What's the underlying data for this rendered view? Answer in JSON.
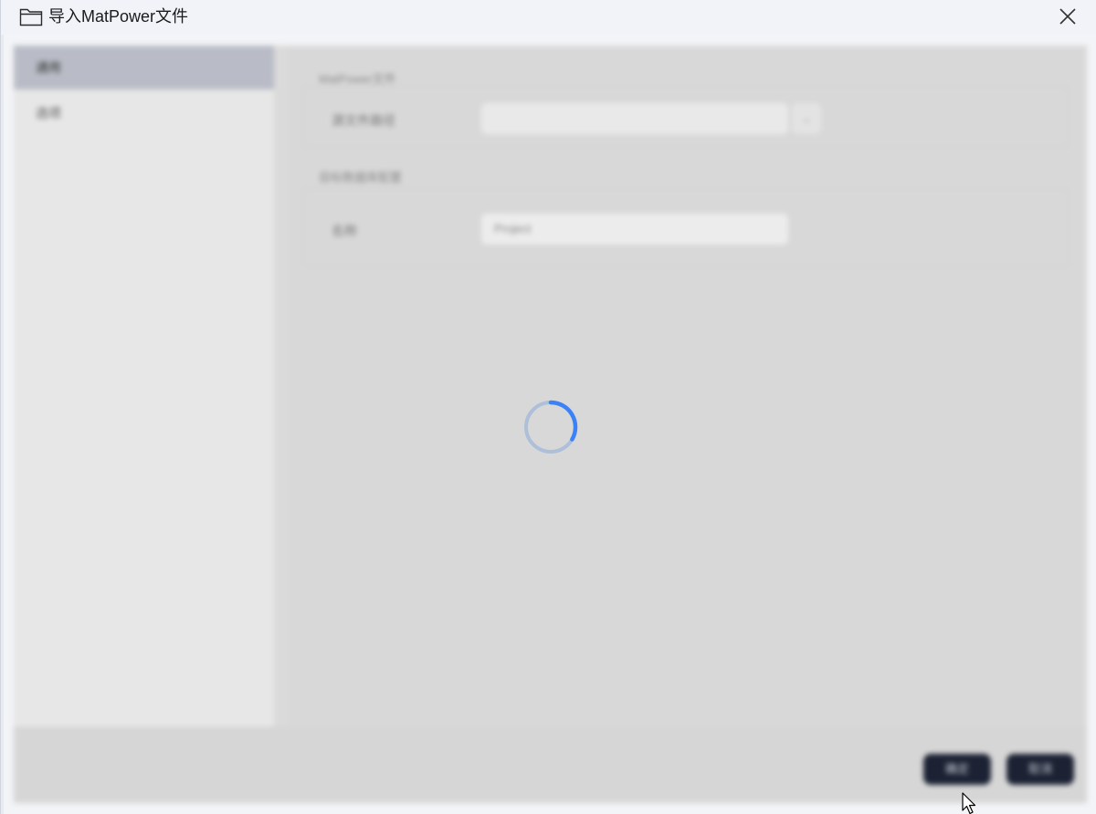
{
  "window": {
    "title": "导入MatPower文件",
    "folder_icon": "folder-icon",
    "close_icon": "close-icon"
  },
  "nav": {
    "items": [
      {
        "label": "通用",
        "active": true
      },
      {
        "label": "选项",
        "active": false
      }
    ]
  },
  "main": {
    "section1": {
      "title": "MatPower文件",
      "field_label": "源文件路径",
      "select_value": ""
    },
    "section2": {
      "title": "目标数据库配置",
      "field_label": "名称",
      "input_value": "Project"
    }
  },
  "footer": {
    "ok_label": "确定",
    "cancel_label": "取消"
  },
  "loading": {
    "indicator": "spinner-icon",
    "accent_color": "#3b82f6"
  }
}
